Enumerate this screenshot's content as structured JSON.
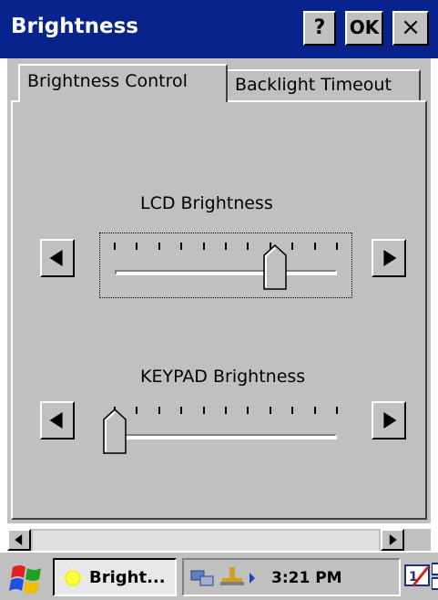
{
  "window": {
    "title": "Brightness",
    "help_label": "?",
    "ok_label": "OK",
    "close_label": "×"
  },
  "tabs": [
    {
      "label": "Brightness Control",
      "active": true
    },
    {
      "label": "Backlight Timeout",
      "active": false
    }
  ],
  "lcd": {
    "label": "LCD Brightness",
    "value_fraction": 0.72,
    "ticks": 11
  },
  "keypad": {
    "label": "KEYPAD Brightness",
    "value_fraction": 0.0,
    "ticks": 11
  },
  "taskbar": {
    "task_label": "Bright...",
    "clock": "3:21 PM",
    "input_indicator": "1"
  },
  "icons": {
    "left_arrow": "left-arrow-icon",
    "right_arrow": "right-arrow-icon",
    "windows_flag": "windows-flag-icon",
    "sun": "sun-icon",
    "network": "network-icon",
    "usb": "usb-icon",
    "input_panel": "input-panel-icon",
    "desktop": "desktop-icon"
  },
  "colors": {
    "titlebar": "#08248c",
    "face": "#c0c0c0"
  }
}
